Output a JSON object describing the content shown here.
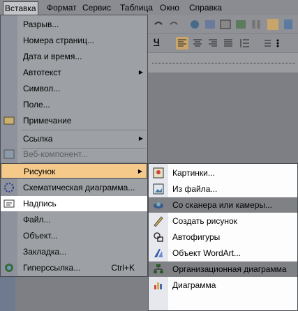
{
  "menubar": {
    "items": [
      {
        "label": "Вставка",
        "active": true
      },
      {
        "label": "Формат"
      },
      {
        "label": "Сервис"
      },
      {
        "label": "Таблица"
      },
      {
        "label": "Окно"
      },
      {
        "label": "Справка"
      }
    ]
  },
  "insert_menu": {
    "items": [
      {
        "label": "Разрыв..."
      },
      {
        "label": "Номера страниц..."
      },
      {
        "label": "Дата и время..."
      },
      {
        "label": "Автотекст"
      },
      {
        "label": "Символ..."
      },
      {
        "label": "Поле..."
      },
      {
        "label": "Примечание"
      },
      {
        "label": "Ссылка"
      },
      {
        "label": "Веб-компонент..."
      },
      {
        "label": "Рисунок"
      },
      {
        "label": "Схематическая диаграмма..."
      },
      {
        "label": "Надпись"
      },
      {
        "label": "Файл..."
      },
      {
        "label": "Объект..."
      },
      {
        "label": "Закладка..."
      },
      {
        "label": "Гиперссылка...",
        "shortcut": "Ctrl+K"
      }
    ]
  },
  "picture_submenu": {
    "items": [
      {
        "label": "Картинки..."
      },
      {
        "label": "Из файла..."
      },
      {
        "label": "Со сканера или камеры..."
      },
      {
        "label": "Создать рисунок"
      },
      {
        "label": "Автофигуры"
      },
      {
        "label": "Объект WordArt..."
      },
      {
        "label": "Организационная диаграмма"
      },
      {
        "label": "Диаграмма"
      }
    ]
  },
  "colors": {
    "selected_item": "#f4c98a",
    "menu_bg": "#9da0a4",
    "submenu_bg": "#fdfdfd"
  }
}
